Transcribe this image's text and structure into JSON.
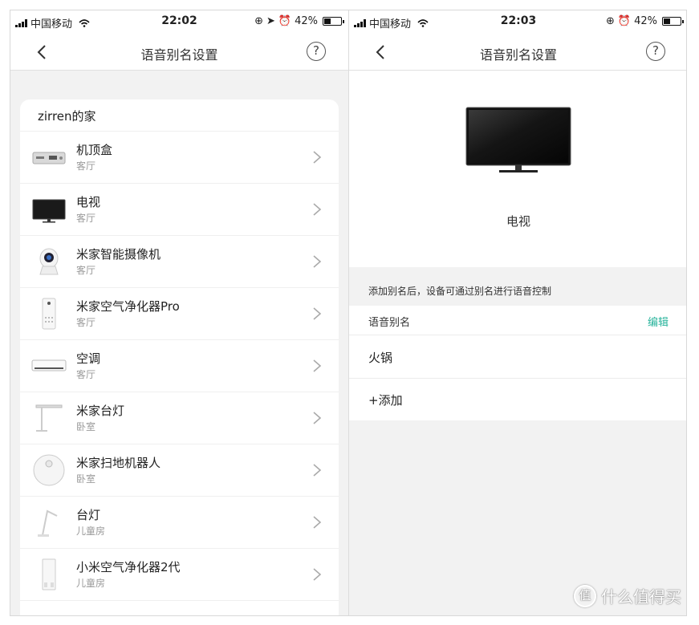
{
  "left": {
    "status": {
      "carrier": "中国移动",
      "time": "22:02",
      "battery": "42%"
    },
    "nav": {
      "title": "语音别名设置",
      "help": "?"
    },
    "home_name": "zirren的家",
    "devices": [
      {
        "name": "机顶盒",
        "room": "客厅",
        "icon": "set-top-box-icon"
      },
      {
        "name": "电视",
        "room": "客厅",
        "icon": "tv-icon"
      },
      {
        "name": "米家智能摄像机",
        "room": "客厅",
        "icon": "camera-icon"
      },
      {
        "name": "米家空气净化器Pro",
        "room": "客厅",
        "icon": "air-purifier-icon"
      },
      {
        "name": "空调",
        "room": "客厅",
        "icon": "air-conditioner-icon"
      },
      {
        "name": "米家台灯",
        "room": "卧室",
        "icon": "desk-lamp-icon"
      },
      {
        "name": "米家扫地机器人",
        "room": "卧室",
        "icon": "robot-vacuum-icon"
      },
      {
        "name": "台灯",
        "room": "儿童房",
        "icon": "desk-lamp-icon"
      },
      {
        "name": "小米空气净化器2代",
        "room": "儿童房",
        "icon": "air-purifier-icon"
      }
    ]
  },
  "right": {
    "status": {
      "carrier": "中国移动",
      "time": "22:03",
      "battery": "42%"
    },
    "nav": {
      "title": "语音别名设置",
      "help": "?"
    },
    "device_name": "电视",
    "hint": "添加别名后，设备可通过别名进行语音控制",
    "alias_header": "语音别名",
    "edit_label": "编辑",
    "aliases": [
      "火锅"
    ],
    "add_label": "+添加"
  },
  "watermark": {
    "text": "什么值得买",
    "logo": "值"
  }
}
